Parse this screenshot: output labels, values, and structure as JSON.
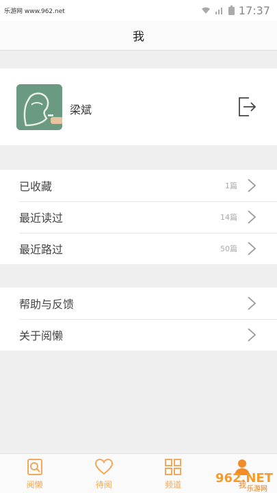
{
  "status": {
    "watermark": "乐游网 www.962.net",
    "time": "17:37"
  },
  "nav": {
    "title": "我"
  },
  "profile": {
    "name": "梁斌"
  },
  "groups": [
    {
      "items": [
        {
          "label": "已收藏",
          "count": "1篇"
        },
        {
          "label": "最近读过",
          "count": "14篇"
        },
        {
          "label": "最近路过",
          "count": "50篇"
        }
      ]
    },
    {
      "items": [
        {
          "label": "帮助与反馈",
          "count": ""
        },
        {
          "label": "关于阅懒",
          "count": ""
        }
      ]
    }
  ],
  "tabs": [
    {
      "label": "阅懒",
      "icon": "magnifier-doc-icon"
    },
    {
      "label": "待阅",
      "icon": "heart-icon"
    },
    {
      "label": "频道",
      "icon": "grid-icon"
    },
    {
      "label": "我",
      "icon": "person-icon"
    }
  ],
  "brand": {
    "mark": "962.NET",
    "sub": "乐游网"
  },
  "colors": {
    "accent": "#f0a85a",
    "avatar_bg": "#6b9a82"
  }
}
